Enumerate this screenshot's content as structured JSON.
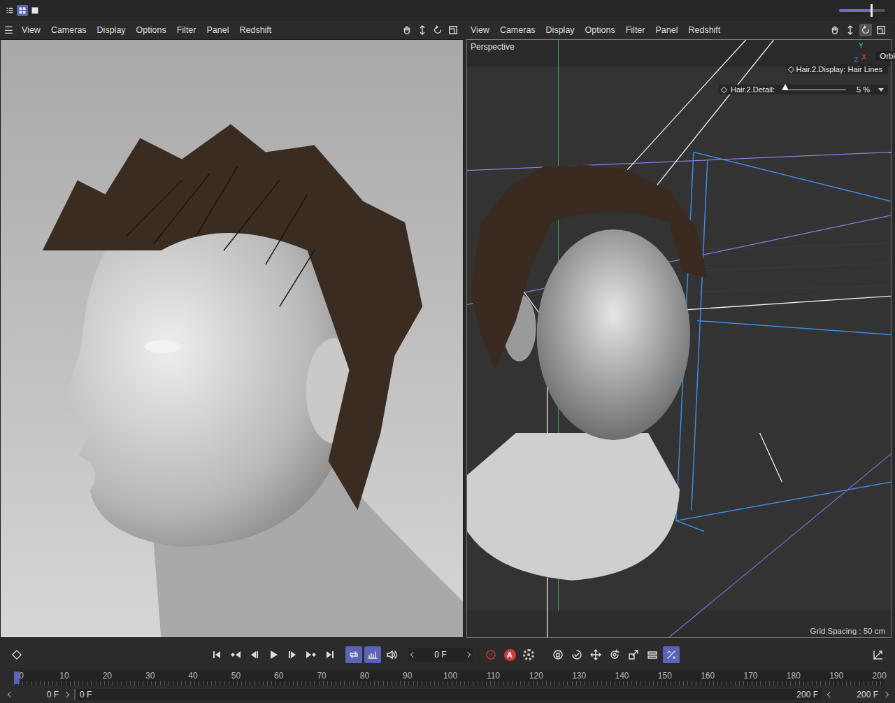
{
  "toolbar": {
    "layouts": [
      {
        "kind": "list",
        "selected": false
      },
      {
        "kind": "grid",
        "selected": true
      },
      {
        "kind": "single",
        "selected": false
      }
    ],
    "zoom": {
      "level": 0.7
    }
  },
  "viewports": [
    {
      "kind": "render",
      "menu_icon": "☰",
      "menu": [
        "View",
        "Cameras",
        "Display",
        "Options",
        "Filter",
        "Panel",
        "Redshift"
      ],
      "nav": [
        {
          "kind": "hand",
          "selected": false
        },
        {
          "kind": "move",
          "selected": false
        },
        {
          "kind": "rotate",
          "selected": false
        },
        {
          "kind": "maximize",
          "selected": false
        }
      ]
    },
    {
      "kind": "editor",
      "menu": [
        "View",
        "Cameras",
        "Display",
        "Options",
        "Filter",
        "Panel",
        "Redshift"
      ],
      "nav": [
        {
          "kind": "hand",
          "selected": false
        },
        {
          "kind": "move",
          "selected": false
        },
        {
          "kind": "rotate",
          "selected": true
        },
        {
          "kind": "maximize",
          "selected": false
        }
      ],
      "label": "Perspective",
      "axis": {
        "y": "Y",
        "x": "X",
        "z": "Z"
      },
      "tooltip": "Orbi",
      "hud": {
        "display": "Hair.2.Display: Hair Lines",
        "detail_label": "Hair.2.Detail:",
        "detail_value": "5 %",
        "detail_level": 0.05
      },
      "grid": "Grid Spacing : 50 cm"
    }
  ],
  "timeline": {
    "transport": [
      {
        "kind": "first"
      },
      {
        "kind": "prev-key"
      },
      {
        "kind": "prev-frame"
      },
      {
        "kind": "play"
      },
      {
        "kind": "next-frame"
      },
      {
        "kind": "next-key"
      },
      {
        "kind": "last"
      }
    ],
    "toggles": [
      {
        "kind": "loop",
        "on": true
      },
      {
        "kind": "timeline",
        "on": true
      },
      {
        "kind": "sound",
        "on": false
      }
    ],
    "frame": "0 F",
    "record": [
      {
        "kind": "record"
      },
      {
        "kind": "autokey",
        "label": "A"
      },
      {
        "kind": "key-settings"
      }
    ],
    "tools": [
      {
        "kind": "motion",
        "on": false
      },
      {
        "kind": "dashed",
        "on": false
      },
      {
        "kind": "move",
        "on": false
      },
      {
        "kind": "rotate",
        "on": false
      },
      {
        "kind": "scale",
        "on": false
      },
      {
        "kind": "param",
        "on": false
      },
      {
        "kind": "snap",
        "on": true
      }
    ],
    "ruler": [
      "0",
      "10",
      "20",
      "30",
      "40",
      "50",
      "60",
      "70",
      "80",
      "90",
      "100",
      "110",
      "120",
      "130",
      "140",
      "150",
      "160",
      "170",
      "180",
      "190",
      "200"
    ],
    "playhead": 0,
    "range": {
      "start": "0 F",
      "min": "0 F",
      "max": "200 F",
      "end": "200 F"
    }
  }
}
